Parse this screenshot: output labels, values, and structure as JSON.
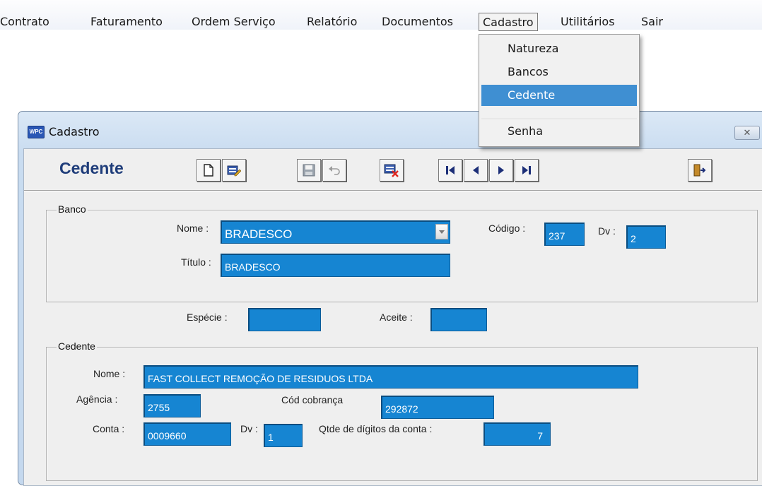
{
  "menubar": {
    "items": [
      "Contrato",
      "Faturamento",
      "Ordem Serviço",
      "Relatório",
      "Documentos",
      "Cadastro",
      "Utilitários",
      "Sair"
    ]
  },
  "dropdown": {
    "items": [
      "Natureza",
      "Bancos",
      "Cedente",
      "Senha"
    ],
    "selected": "Cedente"
  },
  "window": {
    "title": "Cadastro",
    "icon_text": "WPC",
    "close_glyph": "✕",
    "form_title": "Cedente",
    "toolbar_icons": [
      "new-icon",
      "edit-icon",
      "save-icon",
      "undo-icon",
      "delete-icon",
      "first-record-icon",
      "previous-record-icon",
      "next-record-icon",
      "last-record-icon",
      "exit-icon"
    ]
  },
  "banco": {
    "group_label": "Banco",
    "nome_label": "Nome :",
    "nome_value": "BRADESCO",
    "codigo_label": "Código :",
    "codigo_value": "237",
    "dv_label": "Dv :",
    "dv_value": "2",
    "titulo_label": "Título :",
    "titulo_value": "BRADESCO"
  },
  "middle": {
    "especie_label": "Espécie :",
    "especie_value": "",
    "aceite_label": "Aceite :",
    "aceite_value": ""
  },
  "cedente": {
    "group_label": "Cedente",
    "nome_label": "Nome :",
    "nome_value": "FAST COLLECT REMOÇÃO DE RESIDUOS LTDA",
    "agencia_label": "Agência :",
    "agencia_value": "2755",
    "cod_cobranca_label": "Cód cobrança",
    "cod_cobranca_value": "292872",
    "conta_label": "Conta :",
    "conta_value": "0009660",
    "dv_label": "Dv :",
    "dv_value": "1",
    "qtde_label": "Qtde de dígitos da conta :",
    "qtde_value": "7"
  },
  "colors": {
    "field_bg": "#1685d2",
    "menu_highlight": "#3f8fd2",
    "form_title": "#1f3d7a"
  }
}
